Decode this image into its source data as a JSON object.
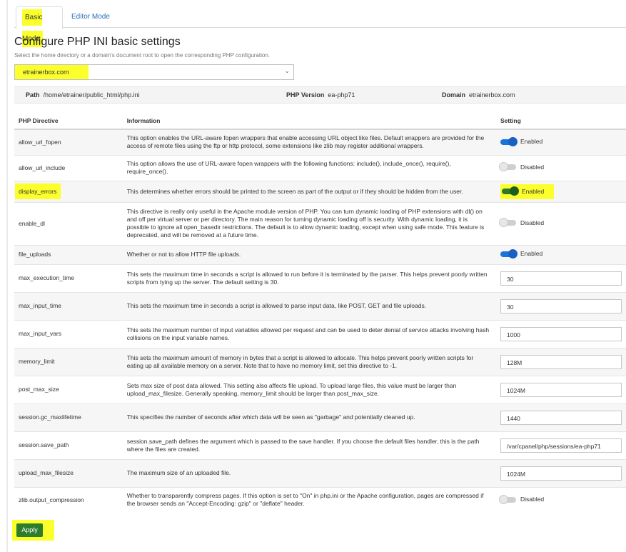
{
  "tabs": [
    {
      "label": "Basic Mode",
      "active": true
    },
    {
      "label": "Editor Mode",
      "active": false
    }
  ],
  "page_title": "Configure PHP INI basic settings",
  "help_text": "Select the home directory or a domain's document root to open the corresponding PHP configuration.",
  "domain_select": {
    "value": "etrainerbox.com"
  },
  "info": {
    "path_label": "Path",
    "path_value": "/home/etrainer/public_html/php.ini",
    "version_label": "PHP Version",
    "version_value": "ea-php71",
    "domain_label": "Domain",
    "domain_value": "etrainerbox.com"
  },
  "table": {
    "headers": {
      "directive": "PHP Directive",
      "info": "Information",
      "setting": "Setting"
    },
    "rows": [
      {
        "directive": "allow_url_fopen",
        "info": "This option enables the URL-aware fopen wrappers that enable accessing URL object like files. Default wrappers are provided for the access of remote files using the ftp or http protocol, some extensions like zlib may register additional wrappers.",
        "type": "toggle",
        "value": "Enabled",
        "on": true
      },
      {
        "directive": "allow_url_include",
        "info": "This option allows the use of URL-aware fopen wrappers with the following functions: include(), include_once(), require(), require_once().",
        "type": "toggle",
        "value": "Disabled",
        "on": false
      },
      {
        "directive": "display_errors",
        "info": "This determines whether errors should be printed to the screen as part of the output or if they should be hidden from the user.",
        "type": "toggle",
        "value": "Enabled",
        "on": true,
        "highlight": true
      },
      {
        "directive": "enable_dl",
        "info": "This directive is really only useful in the Apache module version of PHP. You can turn dynamic loading of PHP extensions with dl() on and off per virtual server or per directory. The main reason for turning dynamic loading off is security. With dynamic loading, it is possible to ignore all open_basedir restrictions. The default is to allow dynamic loading, except when using safe mode. This feature is deprecated, and will be removed at a future time.",
        "type": "toggle",
        "value": "Disabled",
        "on": false
      },
      {
        "directive": "file_uploads",
        "info": "Whether or not to allow HTTP file uploads.",
        "type": "toggle",
        "value": "Enabled",
        "on": true
      },
      {
        "directive": "max_execution_time",
        "info": "This sets the maximum time in seconds a script is allowed to run before it is terminated by the parser. This helps prevent poorly written scripts from tying up the server. The default setting is 30.",
        "type": "input",
        "value": "30"
      },
      {
        "directive": "max_input_time",
        "info": "This sets the maximum time in seconds a script is allowed to parse input data, like POST, GET and file uploads.",
        "type": "input",
        "value": "30"
      },
      {
        "directive": "max_input_vars",
        "info": "This sets the maximum number of input variables allowed per request and can be used to deter denial of service attacks involving hash collisions on the input variable names.",
        "type": "input",
        "value": "1000"
      },
      {
        "directive": "memory_limit",
        "info": "This sets the maximum amount of memory in bytes that a script is allowed to allocate. This helps prevent poorly written scripts for eating up all available memory on a server. Note that to have no memory limit, set this directive to -1.",
        "type": "input",
        "value": "128M"
      },
      {
        "directive": "post_max_size",
        "info": "Sets max size of post data allowed. This setting also affects file upload. To upload large files, this value must be larger than upload_max_filesize. Generally speaking, memory_limit should be larger than post_max_size.",
        "type": "input",
        "value": "1024M"
      },
      {
        "directive": "session.gc_maxlifetime",
        "info": "This specifies the number of seconds after which data will be seen as \"garbage\" and potentially cleaned up.",
        "type": "input",
        "value": "1440"
      },
      {
        "directive": "session.save_path",
        "info": "session.save_path defines the argument which is passed to the save handler. If you choose the default files handler, this is the path where the files are created.",
        "type": "input",
        "value": "/var/cpanel/php/sessions/ea-php71"
      },
      {
        "directive": "upload_max_filesize",
        "info": "The maximum size of an uploaded file.",
        "type": "input",
        "value": "1024M"
      },
      {
        "directive": "zlib.output_compression",
        "info": "Whether to transparently compress pages. If this option is set to \"On\" in php.ini or the Apache configuration, pages are compressed if the browser sends an \"Accept-Encoding: gzip\" or \"deflate\" header.",
        "type": "toggle",
        "value": "Disabled",
        "on": false
      }
    ]
  },
  "apply_label": "Apply",
  "colors": {
    "highlight": "#fbff2c",
    "toggle_on": "#1a73d8",
    "apply": "#2d7d2d"
  }
}
